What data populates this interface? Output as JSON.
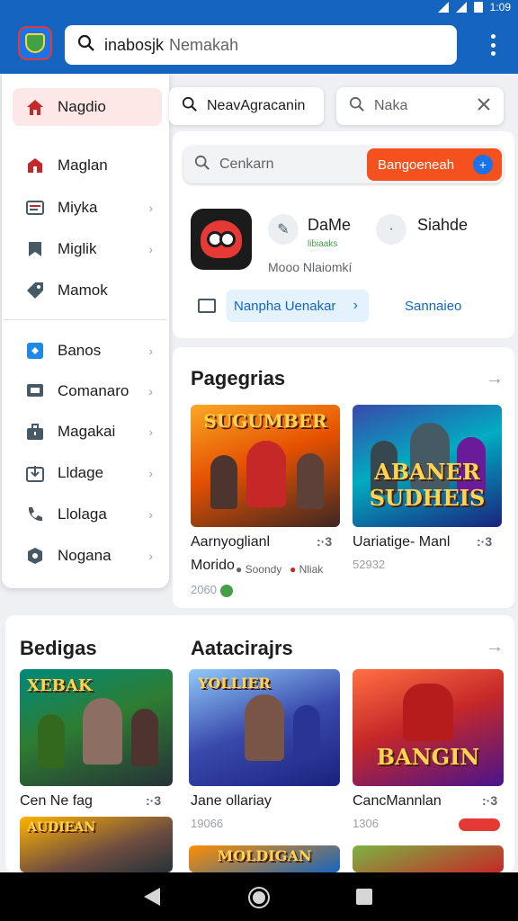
{
  "status_bar": {
    "time": "1:09"
  },
  "header": {
    "search_query": "inabosjk",
    "search_hint": "Nemakah"
  },
  "sidebar": {
    "items": [
      {
        "label": "Nagdio",
        "icon": "home-icon",
        "active": true
      },
      {
        "label": "Maglan",
        "icon": "store-icon"
      },
      {
        "label": "Miyka",
        "icon": "list-icon"
      },
      {
        "label": "Miglik",
        "icon": "bookmark-icon"
      },
      {
        "label": "Mamok",
        "icon": "tag-icon"
      },
      {
        "label": "Banos",
        "icon": "apps-icon"
      },
      {
        "label": "Comanaro",
        "icon": "chat-icon"
      },
      {
        "label": "Magakai",
        "icon": "briefcase-icon"
      },
      {
        "label": "Lldage",
        "icon": "download-icon"
      },
      {
        "label": "Llolaga",
        "icon": "phone-icon"
      },
      {
        "label": "Nogana",
        "icon": "settings-icon"
      }
    ]
  },
  "tabs": {
    "primary": "NeavAgracanin",
    "secondary": "Naka"
  },
  "featured": {
    "search_placeholder": "Cenkarn",
    "action_label": "Bangoeneah",
    "app_title": "DaMe",
    "app_sub": "libiaaks",
    "second_title": "Siahde",
    "meta_line": "Mooo Nlaiomkí",
    "pill_label": "Nanpha Uenakar",
    "link_label": "Sannaieo"
  },
  "section_one": {
    "title": "Pagegrias",
    "games": [
      {
        "name": "Aarnyoglianl",
        "dots": ":·3",
        "tile_text": "SUGUMBER",
        "line2": "Morido",
        "line2b": "Soondy",
        "line2c": "Nliak",
        "count": "2060"
      },
      {
        "name": "Uariatige- Manl",
        "dots": ":·3",
        "tile_text": "ABANER SUDHEIS",
        "count": "52932"
      }
    ]
  },
  "section_two": {
    "title_left": "Bedigas",
    "title_right": "Aatacirajrs",
    "games": [
      {
        "name": "Cen Ne fag",
        "dots": ":·3",
        "tile_text": "XEBAK"
      },
      {
        "name": "Jane ollariay",
        "dots": ":·3",
        "tile_text": "YOLLIER",
        "count": "19066"
      },
      {
        "name": "CancMannlan",
        "dots": ":·3",
        "tile_text": "BANGIN",
        "count": "1306"
      }
    ],
    "bottom_tiles": [
      "AUDIEAN",
      "MOLDIGAN"
    ]
  },
  "colors": {
    "primary": "#1565c0",
    "accent": "#f4511e",
    "active_bg": "#fde7e7"
  }
}
